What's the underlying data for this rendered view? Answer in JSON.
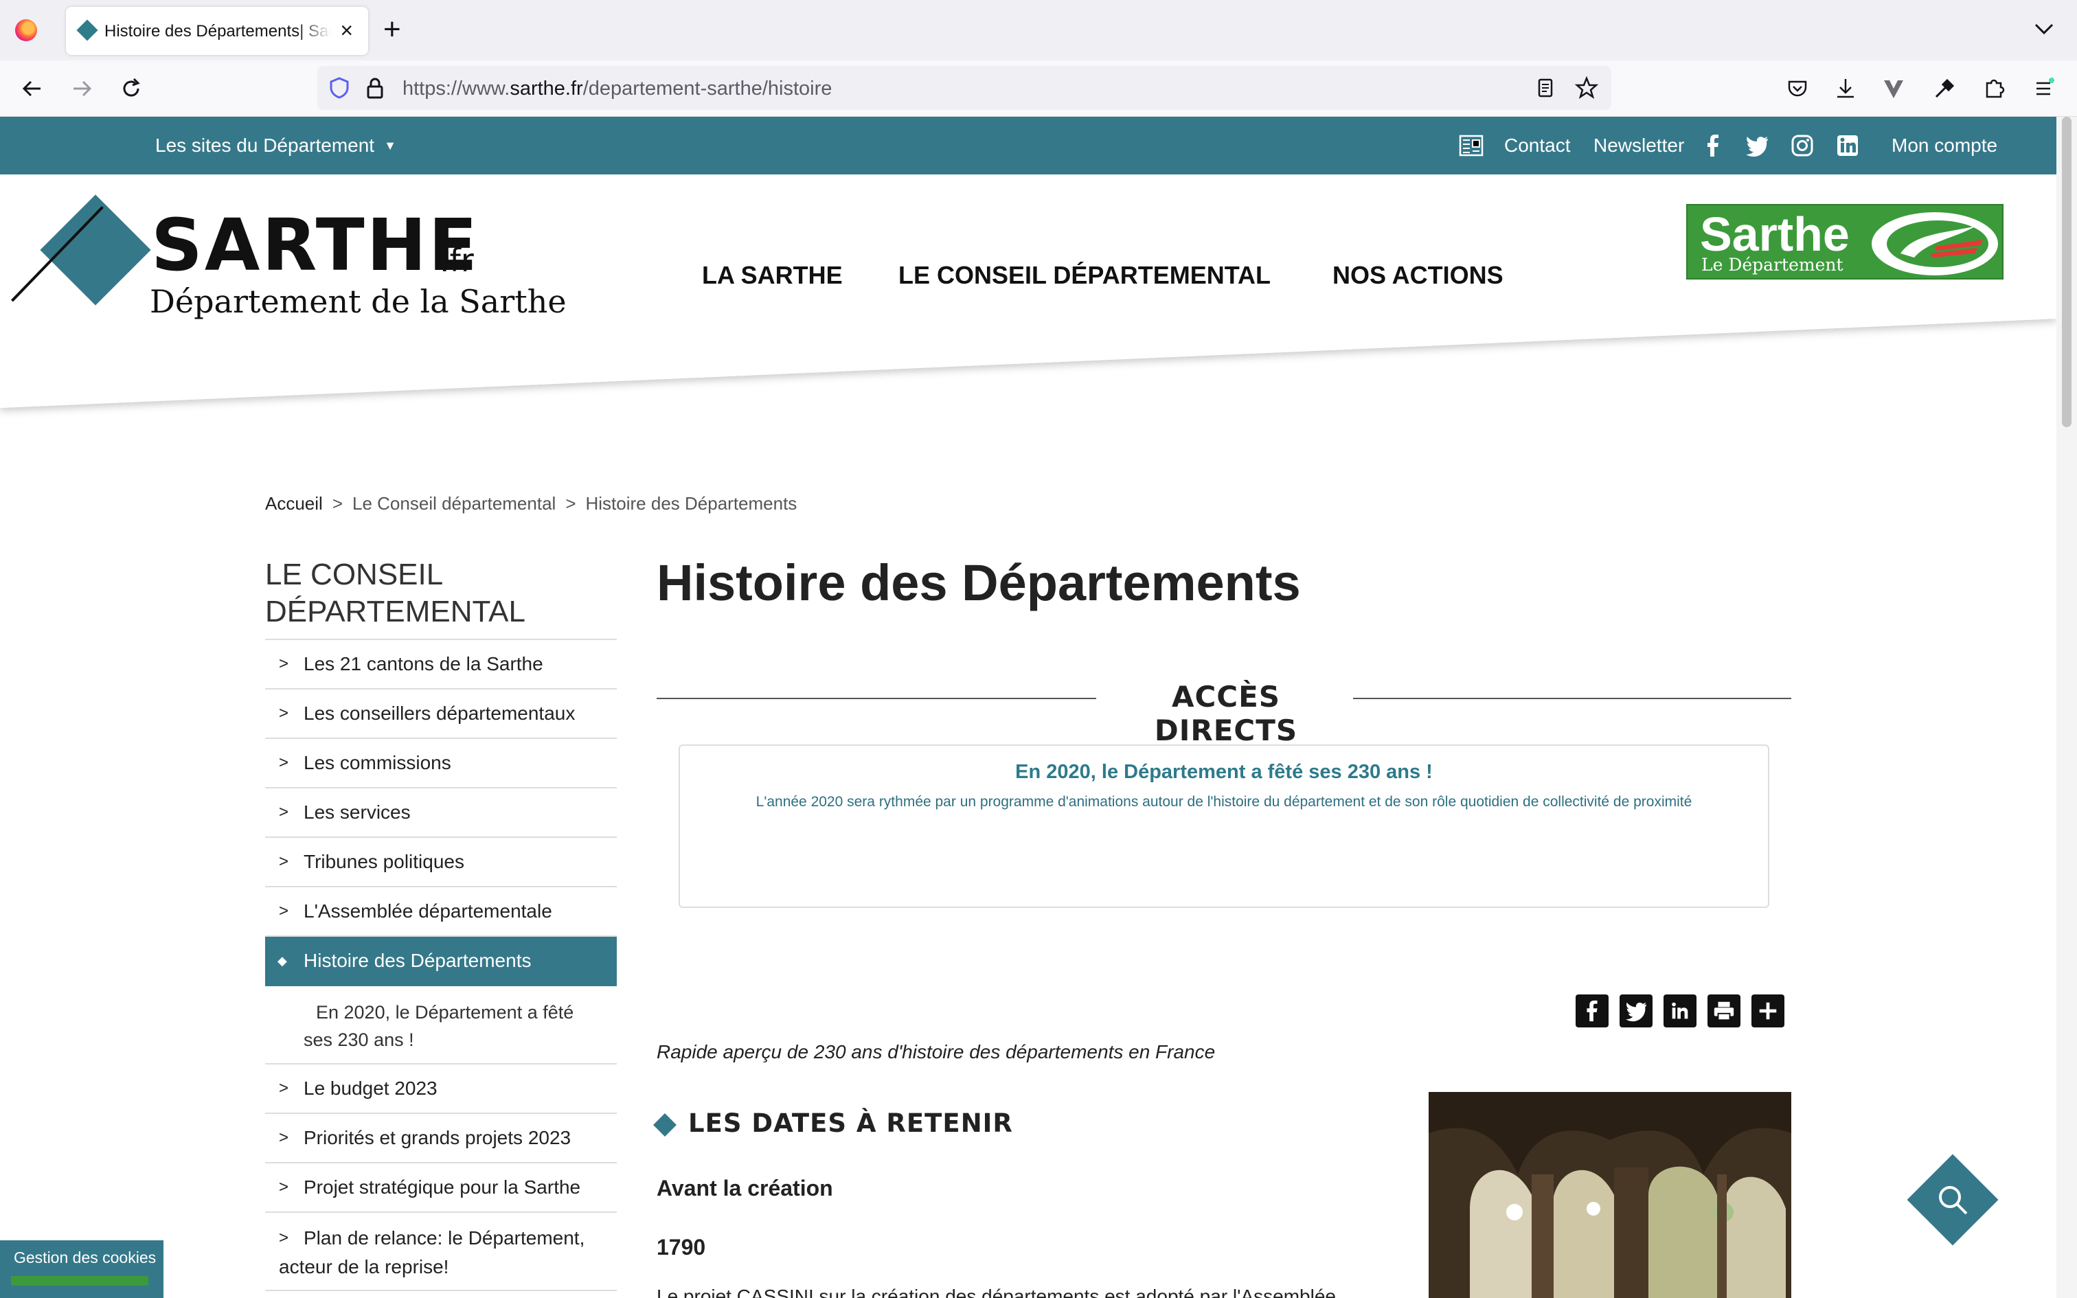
{
  "browser": {
    "tab_title": "Histoire des Départements| Sarthe",
    "url_prefix": "https://www.",
    "url_host": "sarthe.fr",
    "url_path": "/departement-sarthe/histoire"
  },
  "topbar": {
    "sites_label": "Les sites du Département",
    "contact": "Contact",
    "newsletter": "Newsletter",
    "account": "Mon compte"
  },
  "logo": {
    "name": "SARTHE",
    "suffix": ".fr",
    "subtitle": "Département de la Sarthe"
  },
  "main_nav": [
    "LA SARTHE",
    "LE CONSEIL DÉPARTEMENTAL",
    "NOS ACTIONS"
  ],
  "badge": {
    "title": "Sarthe",
    "subtitle": "Le Département"
  },
  "breadcrumb": [
    "Accueil",
    "Le Conseil départemental",
    "Histoire des Départements"
  ],
  "breadcrumb_sep": ">",
  "sidebar": {
    "title": "LE CONSEIL DÉPARTEMENTAL",
    "chevron": ">",
    "active_marker": "◆",
    "items": [
      "Les 21 cantons de la Sarthe",
      "Les conseillers départementaux",
      "Les commissions",
      "Les services",
      "Tribunes politiques",
      "L'Assemblée départementale",
      "Histoire des Départements",
      "En 2020, le Département a fêté ses 230 ans !",
      "Le budget 2023",
      "Priorités et grands projets 2023",
      "Projet stratégique pour la Sarthe",
      "Plan de relance: le Département, acteur de la reprise!"
    ]
  },
  "content": {
    "page_title": "Histoire des Départements",
    "acces_title": "ACCÈS DIRECTS",
    "acces_card_title": "En 2020, le Département a fêté ses 230 ans !",
    "acces_card_text": "L'année 2020 sera rythmée par un programme d'animations autour de l'histoire du département et de son rôle quotidien de collectivité de proximité",
    "intro": "Rapide aperçu de 230 ans d'histoire des départements en France",
    "section_title": "LES DATES À RETENIR",
    "subheading": "Avant la création",
    "year": "1790",
    "body_start": "Le projet CASSINI sur la création des départements est adopté par l'Assemblée"
  },
  "cookie": {
    "label": "Gestion des cookies"
  },
  "colors": {
    "brand_teal": "#35788a",
    "badge_green": "#3c9a3b",
    "link_teal": "#2d7a8b"
  },
  "icons": [
    "firefox-logo",
    "diamond-favicon",
    "close-icon",
    "plus-icon",
    "chevron-down-icon",
    "back-icon",
    "forward-icon",
    "reload-icon",
    "shield-icon",
    "lock-icon",
    "reader-icon",
    "star-icon",
    "pocket-icon",
    "download-icon",
    "extension-v-icon",
    "eyedropper-icon",
    "puzzle-icon",
    "menu-icon",
    "newspaper-icon",
    "facebook-icon",
    "twitter-icon",
    "instagram-icon",
    "linkedin-icon",
    "print-icon",
    "add-icon",
    "search-icon"
  ]
}
